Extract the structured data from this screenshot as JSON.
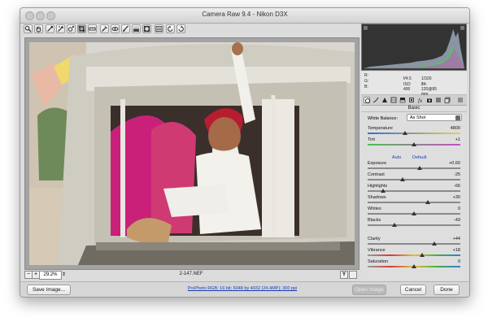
{
  "window": {
    "title": "Camera Raw 9.4  -  Nikon D3X"
  },
  "toolbar": {
    "tools": [
      {
        "name": "zoom-tool-icon"
      },
      {
        "name": "hand-tool-icon"
      },
      {
        "name": "white-balance-tool-icon"
      },
      {
        "name": "color-sampler-tool-icon"
      },
      {
        "name": "targeted-adjustment-tool-icon"
      },
      {
        "name": "crop-tool-icon"
      },
      {
        "name": "straighten-tool-icon"
      },
      {
        "name": "spot-removal-tool-icon"
      },
      {
        "name": "red-eye-removal-tool-icon"
      },
      {
        "name": "adjustment-brush-tool-icon"
      },
      {
        "name": "graduated-filter-tool-icon"
      },
      {
        "name": "radial-filter-tool-icon"
      },
      {
        "name": "preferences-icon"
      },
      {
        "name": "rotate-ccw-icon"
      },
      {
        "name": "rotate-cw-icon"
      }
    ]
  },
  "status": {
    "zoom": "29.2%",
    "filename": "2-147.NEF"
  },
  "workflow_link": "ProPhoto RGB; 16 bit; 6048 by 4032 (24.4MP); 300 ppi",
  "buttons": {
    "save_image": "Save Image...",
    "open_image": "Open Image",
    "cancel": "Cancel",
    "done": "Done"
  },
  "readouts": {
    "r": "R:",
    "g": "G:",
    "b": "B:",
    "aperture": "f/4.5",
    "shutter": "1/320 s",
    "iso": "ISO 400",
    "lens": "24-120@85 mm"
  },
  "panel": {
    "section_title": "Basic",
    "white_balance_label": "White Balance:",
    "white_balance_value": "As Shot",
    "auto_label": "Auto",
    "default_label": "Default",
    "sliders": [
      {
        "label": "Temperature",
        "value": "4800",
        "pos": 0.4
      },
      {
        "label": "Tint",
        "value": "+1",
        "pos": 0.5
      },
      {
        "label": "Exposure",
        "value": "+0.60",
        "pos": 0.56
      },
      {
        "label": "Contrast",
        "value": "-25",
        "pos": 0.38
      },
      {
        "label": "Highlights",
        "value": "-66",
        "pos": 0.17
      },
      {
        "label": "Shadows",
        "value": "+30",
        "pos": 0.65
      },
      {
        "label": "Whites",
        "value": "0",
        "pos": 0.5
      },
      {
        "label": "Blacks",
        "value": "-43",
        "pos": 0.29
      },
      {
        "label": "Clarity",
        "value": "+44",
        "pos": 0.72
      },
      {
        "label": "Vibrance",
        "value": "+18",
        "pos": 0.59
      },
      {
        "label": "Saturation",
        "value": "0",
        "pos": 0.5
      }
    ]
  },
  "colors": {
    "accent_link": "#1a3cb8"
  }
}
